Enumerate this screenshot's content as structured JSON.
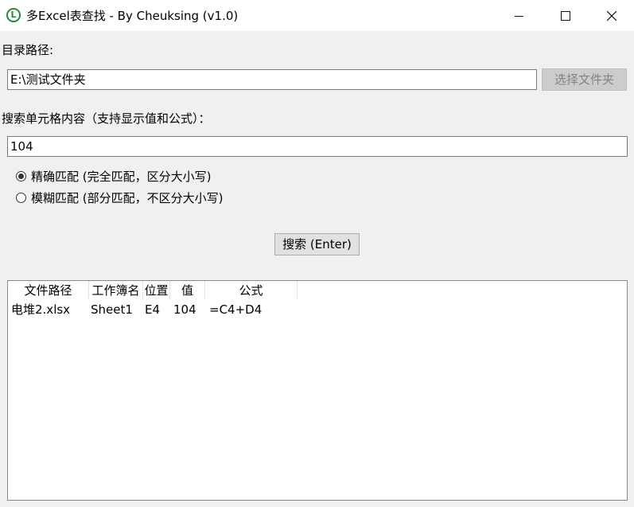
{
  "window": {
    "title": "多Excel表查找 - By Cheuksing (v1.0)",
    "app_icon_letter": "L",
    "accent_color": "#1e8a3a"
  },
  "directory": {
    "label": "目录路径:",
    "value": "E:\\测试文件夹",
    "choose_button": "选择文件夹"
  },
  "search": {
    "label": "搜索单元格内容（支持显示值和公式）：",
    "value": "104",
    "modes": [
      {
        "label": "精确匹配 (完全匹配，区分大小写)",
        "selected": true
      },
      {
        "label": "模糊匹配 (部分匹配，不区分大小写)",
        "selected": false
      }
    ],
    "search_button": "搜索 (Enter)"
  },
  "results": {
    "columns": [
      "文件路径",
      "工作簿名",
      "位置",
      "值",
      "公式"
    ],
    "rows": [
      [
        "电堆2.xlsx",
        "Sheet1",
        "E4",
        "104",
        "=C4+D4"
      ]
    ]
  }
}
